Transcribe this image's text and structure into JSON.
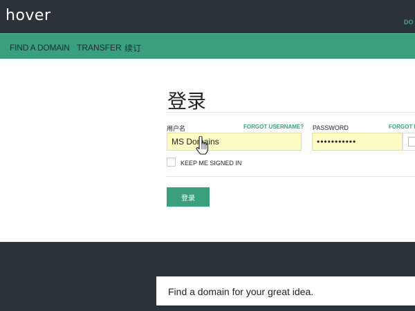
{
  "header": {
    "logo": "hover",
    "top_right_link": "DO"
  },
  "nav": {
    "items": [
      {
        "label": "FIND A DOMAIN"
      },
      {
        "label": "TRANSFER"
      },
      {
        "label": "续订"
      }
    ]
  },
  "login": {
    "title": "登录",
    "username": {
      "label": "用户名",
      "forgot": "FORGOT USERNAME?",
      "value": "MS Domains"
    },
    "password": {
      "label": "PASSWORD",
      "forgot": "FORGOT P",
      "value": "•••••••••••"
    },
    "keep_signed_in": {
      "label": "KEEP ME SIGNED IN",
      "checked": false
    },
    "submit_label": "登录"
  },
  "footer": {
    "search_placeholder": "Find a domain for your great idea."
  },
  "colors": {
    "brand_green": "#3a9f7e",
    "dark_background": "#2d333a",
    "autofill_yellow": "#fbfbc3"
  },
  "icons": {
    "cursor": "hand-pointer-icon"
  }
}
